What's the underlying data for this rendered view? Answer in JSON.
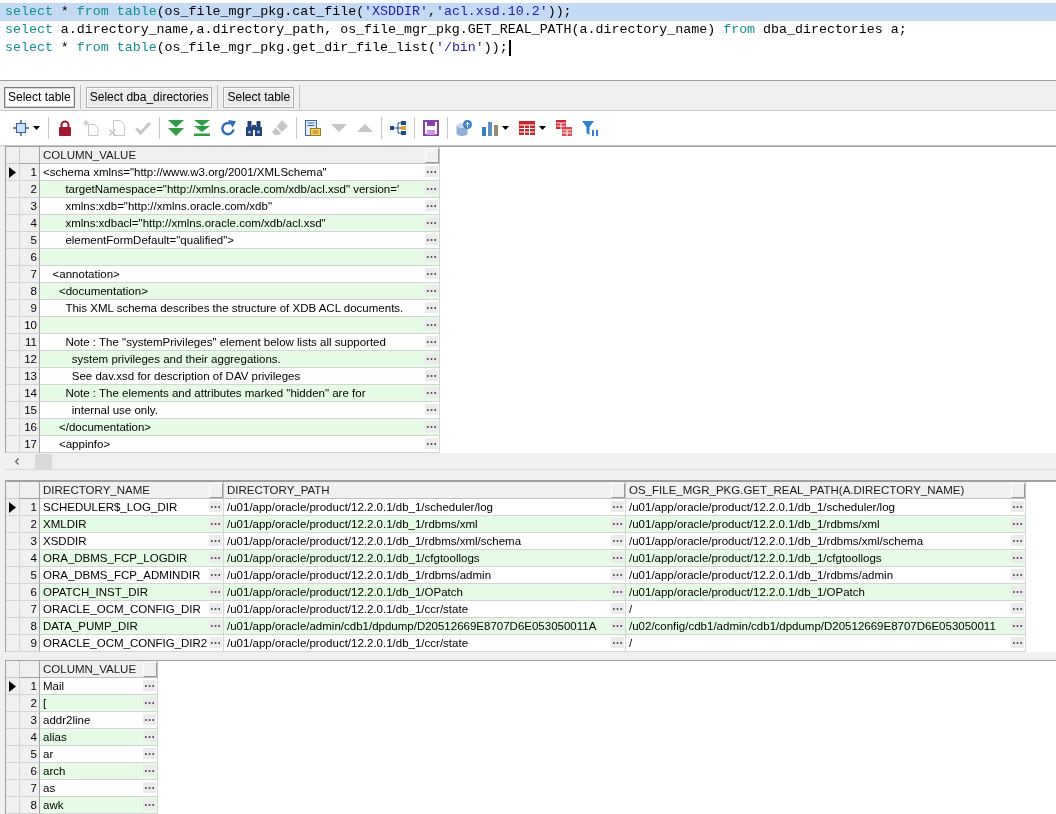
{
  "editor": {
    "lines": [
      {
        "selected": true,
        "cursor": false,
        "tokens": [
          {
            "kind": "keyword",
            "text": "select"
          },
          {
            "kind": "plain",
            "text": " * "
          },
          {
            "kind": "keyword",
            "text": "from table"
          },
          {
            "kind": "plain",
            "text": "(os_file_mgr_pkg.cat_file("
          },
          {
            "kind": "string",
            "text": "'XSDDIR'"
          },
          {
            "kind": "plain",
            "text": ","
          },
          {
            "kind": "string",
            "text": "'acl.xsd.10.2'"
          },
          {
            "kind": "plain",
            "text": "));"
          }
        ]
      },
      {
        "selected": false,
        "cursor": false,
        "tokens": [
          {
            "kind": "keyword",
            "text": "select"
          },
          {
            "kind": "plain",
            "text": " a.directory_name,a.directory_path, os_file_mgr_pkg.GET_REAL_PATH(a.directory_name) "
          },
          {
            "kind": "keyword",
            "text": "from"
          },
          {
            "kind": "plain",
            "text": " dba_directories a;"
          }
        ]
      },
      {
        "selected": false,
        "cursor": true,
        "tokens": [
          {
            "kind": "keyword",
            "text": "select"
          },
          {
            "kind": "plain",
            "text": " * "
          },
          {
            "kind": "keyword",
            "text": "from table"
          },
          {
            "kind": "plain",
            "text": "(os_file_mgr_pkg.get_dir_file_list("
          },
          {
            "kind": "string",
            "text": "'/bin'"
          },
          {
            "kind": "plain",
            "text": "));"
          }
        ]
      }
    ]
  },
  "result_tabs": [
    {
      "label": "Select table",
      "selected": true
    },
    {
      "label": "Select dba_directories",
      "selected": false
    },
    {
      "label": "Select table",
      "selected": false
    }
  ],
  "toolbar": {
    "buttons": [
      {
        "disabled": false,
        "dropdown": true
      },
      {
        "disabled": false,
        "dropdown": false
      },
      {
        "disabled": true,
        "dropdown": false
      },
      {
        "disabled": true,
        "dropdown": false
      },
      {
        "disabled": true,
        "dropdown": false
      },
      {
        "disabled": false,
        "dropdown": false
      },
      {
        "disabled": false,
        "dropdown": false
      },
      {
        "disabled": false,
        "dropdown": false
      },
      {
        "disabled": false,
        "dropdown": false
      },
      {
        "disabled": true,
        "dropdown": false
      },
      {
        "disabled": false,
        "dropdown": false
      },
      {
        "disabled": true,
        "dropdown": false
      },
      {
        "disabled": true,
        "dropdown": false
      },
      {
        "disabled": false,
        "dropdown": false
      },
      {
        "disabled": false,
        "dropdown": false
      },
      {
        "disabled": false,
        "dropdown": false
      },
      {
        "disabled": false,
        "dropdown": true
      },
      {
        "disabled": false,
        "dropdown": true
      },
      {
        "disabled": false,
        "dropdown": false
      },
      {
        "disabled": false,
        "dropdown": false
      }
    ]
  },
  "results": [
    {
      "columns": [
        "COLUMN_VALUE"
      ],
      "rows": [
        {
          "number": "1",
          "selected": true,
          "cells": [
            "<schema xmlns=\"http://www.w3.org/2001/XMLSchema\""
          ]
        },
        {
          "number": "2",
          "selected": false,
          "cells": [
            "       targetNamespace=\"http://xmlns.oracle.com/xdb/acl.xsd\" version='"
          ]
        },
        {
          "number": "3",
          "selected": false,
          "cells": [
            "       xmlns:xdb=\"http://xmlns.oracle.com/xdb\""
          ]
        },
        {
          "number": "4",
          "selected": false,
          "cells": [
            "       xmlns:xdbacl=\"http://xmlns.oracle.com/xdb/acl.xsd\""
          ]
        },
        {
          "number": "5",
          "selected": false,
          "cells": [
            "       elementFormDefault=\"qualified\">"
          ]
        },
        {
          "number": "6",
          "selected": false,
          "cells": []
        },
        {
          "number": "7",
          "selected": false,
          "cells": [
            "   <annotation>"
          ]
        },
        {
          "number": "8",
          "selected": false,
          "cells": [
            "     <documentation>"
          ]
        },
        {
          "number": "9",
          "selected": false,
          "cells": [
            "       This XML schema describes the structure of XDB ACL documents."
          ]
        },
        {
          "number": "10",
          "selected": false,
          "cells": []
        },
        {
          "number": "11",
          "selected": false,
          "cells": [
            "       Note : The \"systemPrivileges\" element below lists all supported"
          ]
        },
        {
          "number": "12",
          "selected": false,
          "cells": [
            "         system privileges and their aggregations."
          ]
        },
        {
          "number": "13",
          "selected": false,
          "cells": [
            "         See dav.xsd for description of DAV privileges"
          ]
        },
        {
          "number": "14",
          "selected": false,
          "cells": [
            "       Note : The elements and attributes marked \"hidden\" are for"
          ]
        },
        {
          "number": "15",
          "selected": false,
          "cells": [
            "         internal use only."
          ]
        },
        {
          "number": "16",
          "selected": false,
          "cells": [
            "     </documentation>"
          ]
        },
        {
          "number": "17",
          "selected": false,
          "cells": [
            "     <appinfo>"
          ]
        }
      ]
    },
    {
      "columns": [
        "DIRECTORY_NAME",
        "DIRECTORY_PATH",
        "OS_FILE_MGR_PKG.GET_REAL_PATH(A.DIRECTORY_NAME)"
      ],
      "rows": [
        {
          "number": "1",
          "selected": true,
          "cells": [
            "SCHEDULER$_LOG_DIR",
            "/u01/app/oracle/product/12.2.0.1/db_1/scheduler/log",
            "/u01/app/oracle/product/12.2.0.1/db_1/scheduler/log"
          ]
        },
        {
          "number": "2",
          "selected": false,
          "cells": [
            "XMLDIR",
            "/u01/app/oracle/product/12.2.0.1/db_1/rdbms/xml",
            "/u01/app/oracle/product/12.2.0.1/db_1/rdbms/xml"
          ]
        },
        {
          "number": "3",
          "selected": false,
          "cells": [
            "XSDDIR",
            "/u01/app/oracle/product/12.2.0.1/db_1/rdbms/xml/schema",
            "/u01/app/oracle/product/12.2.0.1/db_1/rdbms/xml/schema"
          ]
        },
        {
          "number": "4",
          "selected": false,
          "cells": [
            "ORA_DBMS_FCP_LOGDIR",
            "/u01/app/oracle/product/12.2.0.1/db_1/cfgtoollogs",
            "/u01/app/oracle/product/12.2.0.1/db_1/cfgtoollogs"
          ]
        },
        {
          "number": "5",
          "selected": false,
          "cells": [
            "ORA_DBMS_FCP_ADMINDIR",
            "/u01/app/oracle/product/12.2.0.1/db_1/rdbms/admin",
            "/u01/app/oracle/product/12.2.0.1/db_1/rdbms/admin"
          ]
        },
        {
          "number": "6",
          "selected": false,
          "cells": [
            "OPATCH_INST_DIR",
            "/u01/app/oracle/product/12.2.0.1/db_1/OPatch",
            "/u01/app/oracle/product/12.2.0.1/db_1/OPatch"
          ]
        },
        {
          "number": "7",
          "selected": false,
          "cells": [
            "ORACLE_OCM_CONFIG_DIR",
            "/u01/app/oracle/product/12.2.0.1/db_1/ccr/state",
            "/"
          ]
        },
        {
          "number": "8",
          "selected": false,
          "cells": [
            "DATA_PUMP_DIR",
            "/u01/app/oracle/admin/cdb1/dpdump/D20512669E8707D6E053050011A",
            "/u02/config/cdb1/admin/cdb1/dpdump/D20512669E8707D6E053050011"
          ]
        },
        {
          "number": "9",
          "selected": false,
          "cells": [
            "ORACLE_OCM_CONFIG_DIR2",
            "/u01/app/oracle/product/12.2.0.1/db_1/ccr/state",
            "/"
          ]
        }
      ]
    },
    {
      "columns": [
        "COLUMN_VALUE"
      ],
      "rows": [
        {
          "number": "1",
          "selected": true,
          "cells": [
            "Mail"
          ]
        },
        {
          "number": "2",
          "selected": false,
          "cells": [
            "["
          ]
        },
        {
          "number": "3",
          "selected": false,
          "cells": [
            "addr2line"
          ]
        },
        {
          "number": "4",
          "selected": false,
          "cells": [
            "alias"
          ]
        },
        {
          "number": "5",
          "selected": false,
          "cells": [
            "ar"
          ]
        },
        {
          "number": "6",
          "selected": false,
          "cells": [
            "arch"
          ]
        },
        {
          "number": "7",
          "selected": false,
          "cells": [
            "as"
          ]
        },
        {
          "number": "8",
          "selected": false,
          "cells": [
            "awk"
          ]
        }
      ]
    }
  ]
}
